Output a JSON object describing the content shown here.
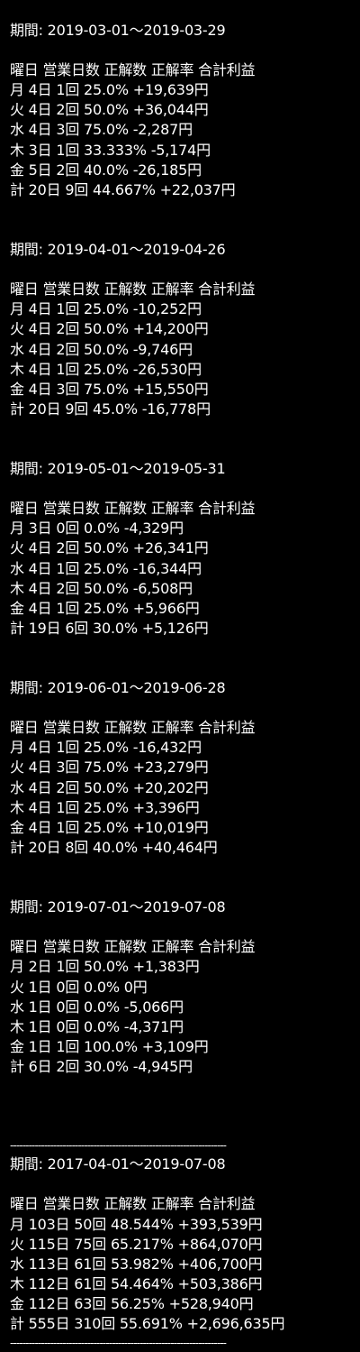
{
  "sections": [
    {
      "period": "期間: 2019-03-01〜2019-03-29",
      "header": "曜日 営業日数 正解数 正解率 合計利益",
      "rows": [
        "月 4日 1回 25.0% +19,639円",
        "火 4日 2回 50.0% +36,044円",
        "水 4日 3回 75.0% -2,287円",
        "木 3日 1回 33.333% -5,174円",
        "金 5日 2回 40.0% -26,185円",
        "計 20日 9回 44.667% +22,037円"
      ]
    },
    {
      "period": "期間: 2019-04-01〜2019-04-26",
      "header": "曜日 営業日数 正解数 正解率 合計利益",
      "rows": [
        "月 4日 1回 25.0% -10,252円",
        "火 4日 2回 50.0% +14,200円",
        "水 4日 2回 50.0% -9,746円",
        "木 4日 1回 25.0% -26,530円",
        "金 4日 3回 75.0% +15,550円",
        "計 20日 9回 45.0% -16,778円"
      ]
    },
    {
      "period": "期間: 2019-05-01〜2019-05-31",
      "header": "曜日 営業日数 正解数 正解率 合計利益",
      "rows": [
        "月 3日 0回 0.0% -4,329円",
        "火 4日 2回 50.0% +26,341円",
        "水 4日 1回 25.0% -16,344円",
        "木 4日 2回 50.0% -6,508円",
        "金 4日 1回 25.0% +5,966円",
        "計 19日 6回 30.0% +5,126円"
      ]
    },
    {
      "period": "期間: 2019-06-01〜2019-06-28",
      "header": "曜日 営業日数 正解数 正解率 合計利益",
      "rows": [
        "月 4日 1回 25.0% -16,432円",
        "火 4日 3回 75.0% +23,279円",
        "水 4日 2回 50.0% +20,202円",
        "木 4日 1回 25.0% +3,396円",
        "金 4日 1回 25.0% +10,019円",
        "計 20日 8回 40.0% +40,464円"
      ]
    },
    {
      "period": "期間: 2019-07-01〜2019-07-08",
      "header": "曜日 営業日数 正解数 正解率 合計利益",
      "rows": [
        "月 2日 1回 50.0% +1,383円",
        "火 1日 0回 0.0% 0円",
        "水 1日 0回 0.0% -5,066円",
        "木 1日 0回 0.0% -4,371円",
        "金 1日 1回 100.0% +3,109円",
        "計 6日 2回 30.0% -4,945円"
      ]
    }
  ],
  "summary": {
    "divider": "----------------------------------------------------------------------",
    "period": "期間: 2017-04-01〜2019-07-08",
    "header": "曜日 営業日数 正解数 正解率 合計利益",
    "rows": [
      "月 103日 50回 48.544% +393,539円",
      "火 115日 75回 65.217% +864,070円",
      "水 113日 61回 53.982% +406,700円",
      "木 112日 61回 54.464% +503,386円",
      "金 112日 63回 56.25% +528,940円",
      "計 555日 310回 55.691% +2,696,635円"
    ]
  }
}
